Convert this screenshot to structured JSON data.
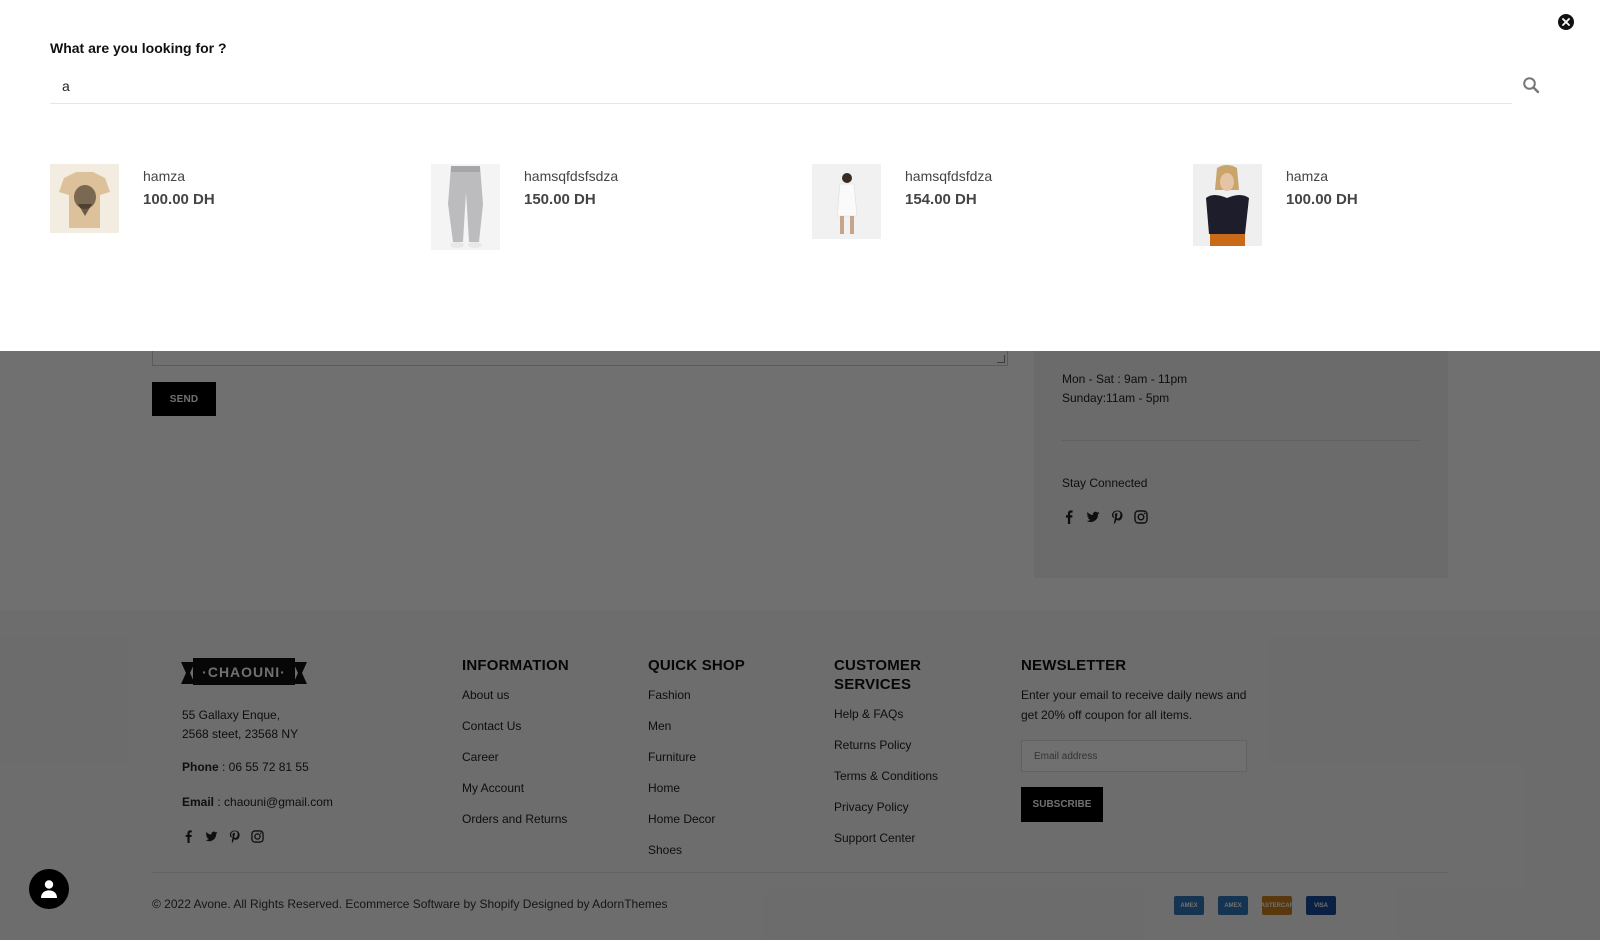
{
  "search": {
    "heading": "What are you looking for ?",
    "query": "a",
    "results": [
      {
        "name": "hamza",
        "price": "100.00 DH",
        "image": "t-shirt"
      },
      {
        "name": "hamsqfdsfsdza",
        "price": "150.00 DH",
        "image": "grey jogger pants"
      },
      {
        "name": "hamsqfdsfdza",
        "price": "154.00 DH",
        "image": "woman in white outfit"
      },
      {
        "name": "hamza",
        "price": "100.00 DH",
        "image": "woman in black puff-sleeve top"
      }
    ]
  },
  "contact": {
    "send_label": "SEND",
    "hours": [
      "Mon - Sat : 9am - 11pm",
      "Sunday:11am - 5pm"
    ],
    "stay_connected": "Stay Connected",
    "social_icons": [
      "facebook-icon",
      "twitter-icon",
      "pinterest-icon",
      "instagram-icon"
    ]
  },
  "footer": {
    "logo_text": "·CHAOUNI·",
    "address_line1": "55 Gallaxy Enque,",
    "address_line2": "2568 steet, 23568 NY",
    "phone_label": "Phone",
    "phone_value": " : 06 55 72 81 55",
    "email_label": "Email",
    "email_value": " : chaouni@gmail.com",
    "information": {
      "title": "INFORMATION",
      "links": [
        "About us",
        "Contact Us",
        "Career",
        "My Account",
        "Orders and Returns"
      ]
    },
    "quick_shop": {
      "title": "QUICK SHOP",
      "links": [
        "Fashion",
        "Men",
        "Furniture",
        "Home",
        "Home Decor",
        "Shoes"
      ]
    },
    "customer_services": {
      "title": "CUSTOMER SERVICES",
      "links": [
        "Help & FAQs",
        "Returns Policy",
        "Terms & Conditions",
        "Privacy Policy",
        "Support Center"
      ]
    },
    "newsletter": {
      "title": "NEWSLETTER",
      "text": "Enter your email to receive daily news and get 20% off coupon for all items.",
      "placeholder": "Email address",
      "button": "SUBSCRIBE"
    },
    "copyright": "© 2022 Avone. All Rights Reserved. Ecommerce Software by Shopify Designed by AdornThemes",
    "payments": [
      "AMEX",
      "AMEX",
      "MASTERCARD",
      "VISA"
    ],
    "payment_colors": [
      "#2e77bc",
      "#2e77bc",
      "#c9801c",
      "#1a4d9c"
    ]
  },
  "colors": {
    "accent": "#000000",
    "overlay": "rgba(0,0,0,0.56)"
  }
}
